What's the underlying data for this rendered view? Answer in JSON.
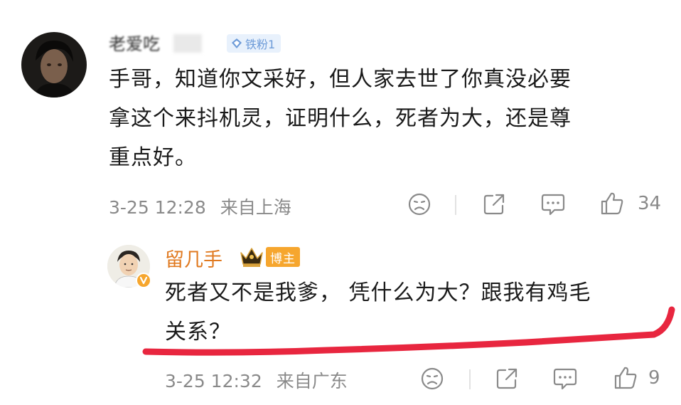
{
  "comments": [
    {
      "username": "老爱吃",
      "fan_badge": "铁粉1",
      "text_lines": [
        "手哥，知道你文采好，但人家去世了你真没必要",
        "拿这个来抖机灵，证明什么，死者为大，还是尊",
        "重点好。"
      ],
      "time": "3-25 12:28",
      "location": "来自上海",
      "likes": "34"
    },
    {
      "username": "留几手",
      "role_badge": "博主",
      "text_lines": [
        "死者又不是我爹， 凭什么为大？跟我有鸡毛",
        "关系？"
      ],
      "time": "3-25 12:32",
      "location": "来自广东",
      "likes": "9"
    }
  ],
  "icons": [
    "dislike-face-icon",
    "share-icon",
    "comment-bubble-icon",
    "thumbs-up-icon",
    "crown-icon",
    "verified-v-icon"
  ],
  "colors": {
    "username_orange": "#e0791f",
    "fan_badge_blue": "#6d9bd8",
    "host_badge": "#f6a62e",
    "annotation_red": "#e8263f",
    "meta_gray": "#8a8a8a"
  }
}
